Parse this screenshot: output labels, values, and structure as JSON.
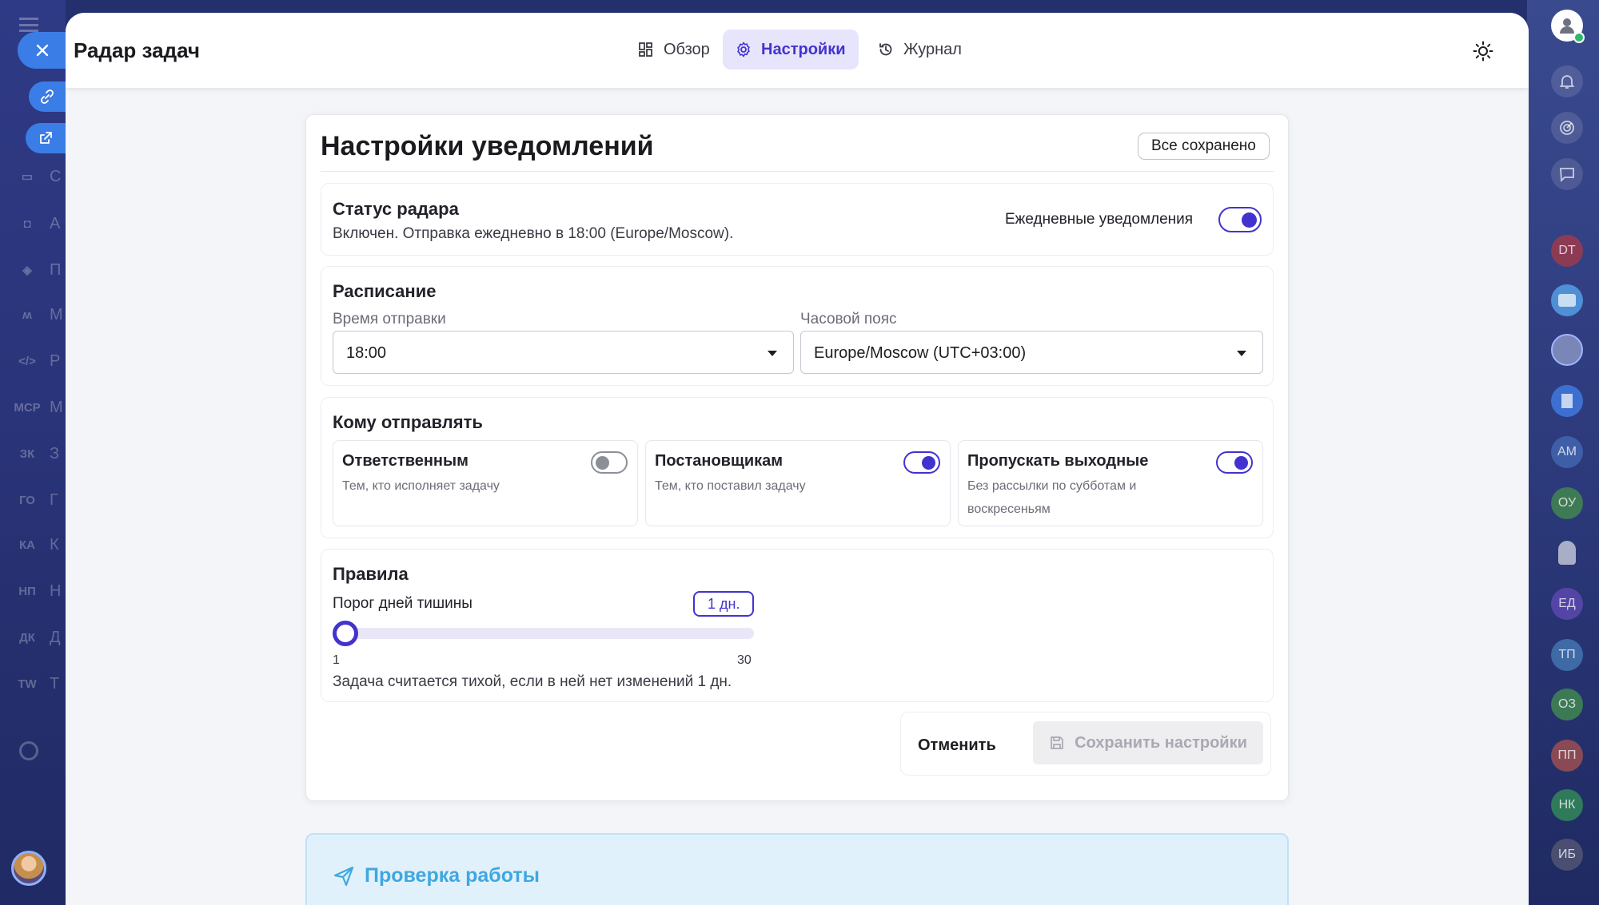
{
  "app": {
    "title": "Радар задач"
  },
  "tabs": [
    {
      "label": "Обзор",
      "icon": "dashboard-icon"
    },
    {
      "label": "Настройки",
      "icon": "gear-icon",
      "active": true
    },
    {
      "label": "Журнал",
      "icon": "history-icon"
    }
  ],
  "left_nav": {
    "items": [
      {
        "icon": "pencil-icon",
        "label": ""
      },
      {
        "icon": "id-card-icon",
        "label": "С"
      },
      {
        "icon": "robot-icon",
        "label": "А"
      },
      {
        "icon": "box-icon",
        "label": "П"
      },
      {
        "icon": "m-logo-icon",
        "label": "М"
      },
      {
        "icon": "code-icon",
        "label": "Р"
      },
      {
        "icon": "mcp-icon",
        "badge": "MCP",
        "label": "М"
      },
      {
        "icon": "avatar-icon",
        "badge": "ЗК",
        "label": "З"
      },
      {
        "icon": "avatar-icon",
        "badge": "ГО",
        "label": "Г"
      },
      {
        "icon": "avatar-icon",
        "badge": "КА",
        "label": "К"
      },
      {
        "icon": "avatar-icon",
        "badge": "НП",
        "label": "Н"
      },
      {
        "icon": "avatar-icon",
        "badge": "ДК",
        "label": "Д"
      },
      {
        "icon": "avatar-icon",
        "badge": "TW",
        "label": "Т"
      }
    ]
  },
  "right_sidebar": {
    "avatars": [
      "DT",
      "АМ",
      "ОУ",
      "ЕД",
      "ТП",
      "ОЗ",
      "ПП",
      "НК",
      "ИБ"
    ]
  },
  "settings": {
    "title": "Настройки уведомлений",
    "saved_status": "Все сохранено",
    "radar_status": {
      "title": "Статус радара",
      "description": "Включен. Отправка ежедневно в 18:00 (Europe/Moscow).",
      "daily_label": "Ежедневные уведомления",
      "daily_enabled": true
    },
    "schedule": {
      "title": "Расписание",
      "time_label": "Время отправки",
      "time_value": "18:00",
      "tz_label": "Часовой пояс",
      "tz_value": "Europe/Moscow (UTC+03:00)"
    },
    "recipients": {
      "title": "Кому отправлять",
      "options": [
        {
          "title": "Ответственным",
          "description": "Тем, кто исполняет задачу",
          "enabled": false
        },
        {
          "title": "Постановщикам",
          "description": "Тем, кто поставил задачу",
          "enabled": true
        },
        {
          "title": "Пропускать выходные",
          "description": "Без рассылки по субботам и воскресеньям",
          "enabled": true
        }
      ]
    },
    "rules": {
      "title": "Правила",
      "threshold_label": "Порог дней тишины",
      "threshold_badge": "1 дн.",
      "threshold_value": 1,
      "min": "1",
      "max": "30",
      "hint": "Задача считается тихой, если в ней нет изменений 1 дн."
    },
    "actions": {
      "cancel": "Отменить",
      "save": "Сохранить настройки"
    }
  },
  "test_section": {
    "title": "Проверка работы"
  },
  "colors": {
    "accent": "#4233cf",
    "test_blue": "#3fa7e0"
  }
}
